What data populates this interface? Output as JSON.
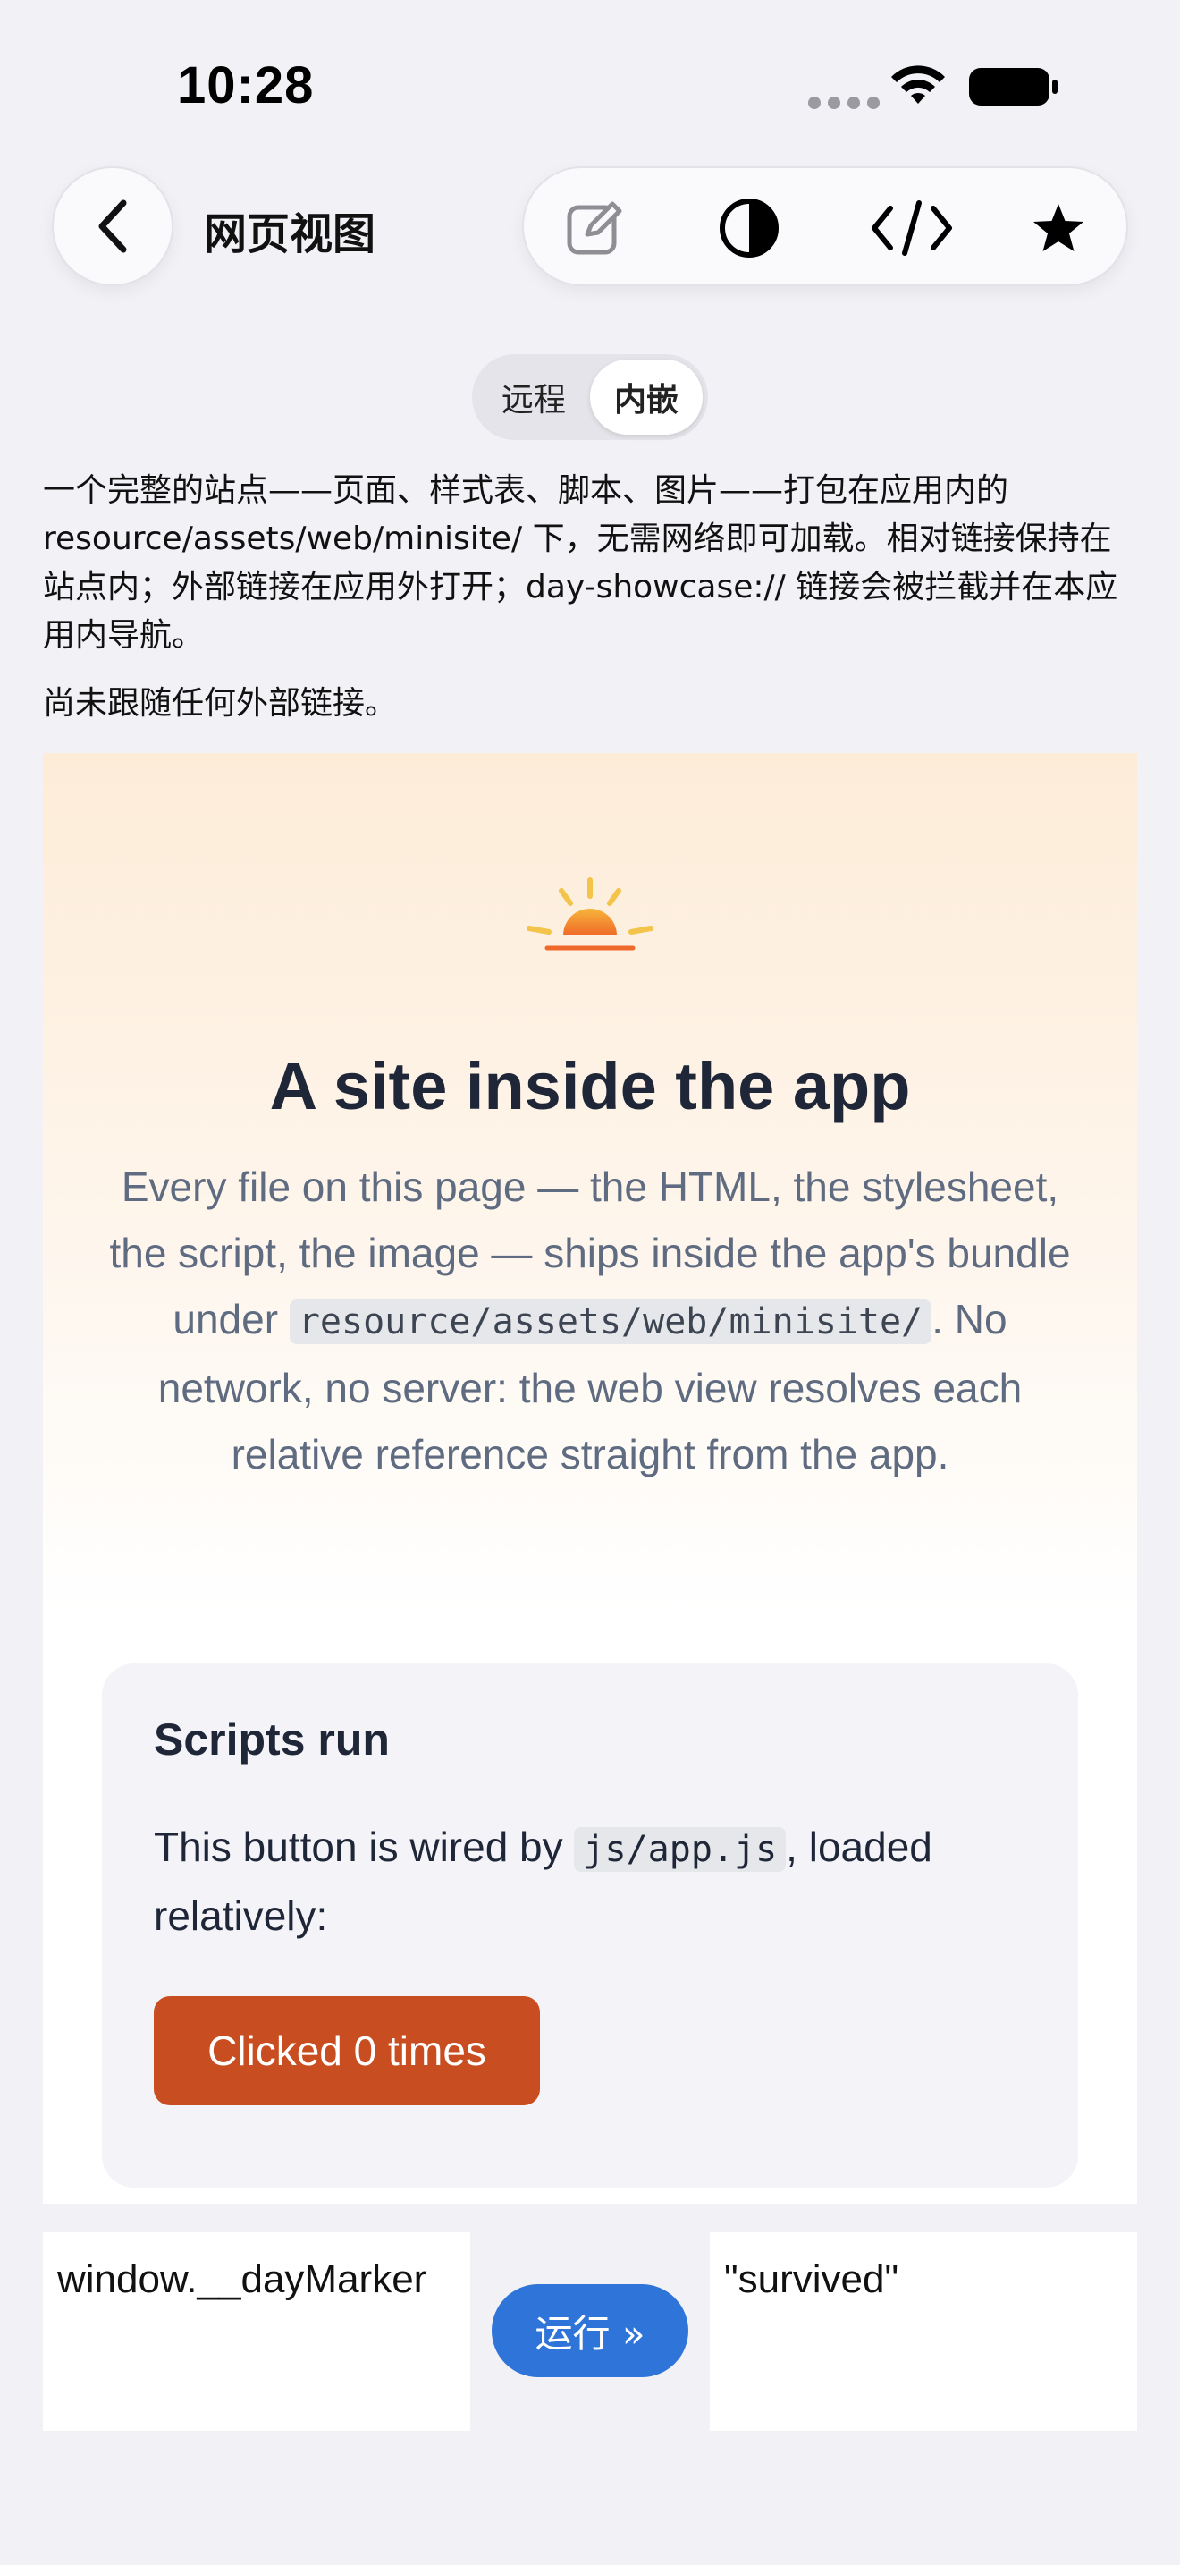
{
  "status_bar": {
    "time": "10:28",
    "icons": [
      "signal-dots-icon",
      "wifi-icon",
      "battery-icon"
    ]
  },
  "nav": {
    "back_icon": "chevron-left-icon",
    "title": "网页视图",
    "toolbar_icons": [
      "edit-icon",
      "contrast-icon",
      "code-icon",
      "star-icon"
    ]
  },
  "segmented": {
    "options": [
      "远程",
      "内嵌"
    ],
    "selected": "内嵌"
  },
  "description": "一个完整的站点——页面、样式表、脚本、图片——打包在应用内的 resource/assets/web/minisite/ 下，无需网络即可加载。相对链接保持在站点内；外部链接在应用外打开；day-showcase:// 链接会被拦截并在本应用内导航。",
  "link_status": "尚未跟随任何外部链接。",
  "webview": {
    "logo_icon": "sunrise-icon",
    "title": "A site inside the app",
    "intro_before": "Every file on this page — the HTML, the stylesheet, the script, the image — ships inside the app's bundle under ",
    "intro_code": "resource/assets/web/minisite/",
    "intro_after": ". No network, no server: the web view resolves each relative reference straight from the app.",
    "card": {
      "title": "Scripts run",
      "text_before": "This button is wired by ",
      "text_code": "js/app.js",
      "text_after": ", loaded relatively:",
      "button_label": "Clicked 0 times"
    }
  },
  "eval": {
    "input_value": "window.__dayMarker",
    "run_label": "运行 »",
    "output_value": "\"survived\""
  },
  "colors": {
    "background": "#f1f1f6",
    "accent_orange": "#c84d20",
    "run_blue": "#2f74d8",
    "title_navy": "#1e2638",
    "intro_gray": "#5e6b80"
  }
}
